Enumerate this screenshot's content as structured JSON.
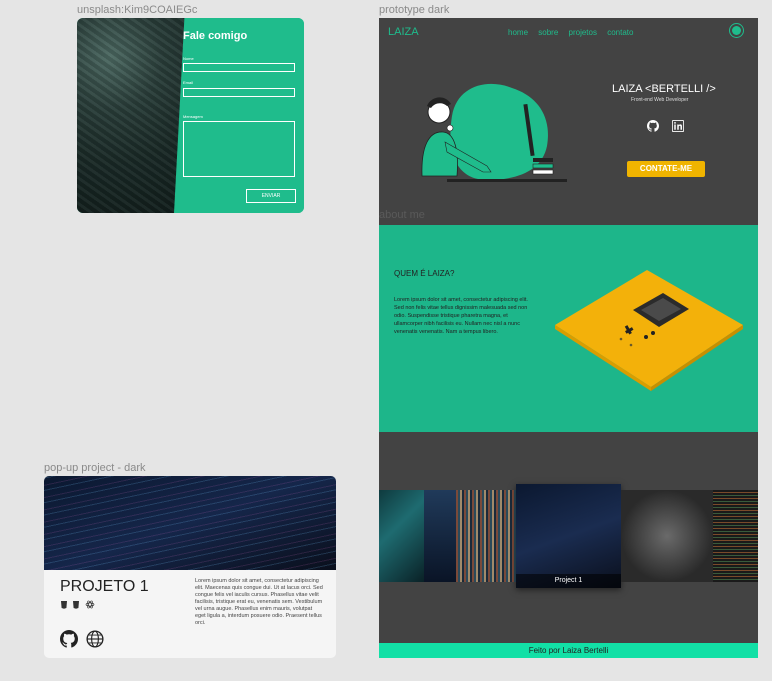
{
  "labels": {
    "contact_frame": "unsplash:Kim9COAIEGc",
    "prototype_frame": "prototype dark",
    "about_frame": "about me",
    "popup_frame": "pop-up project - dark"
  },
  "contact": {
    "title": "Fale comigo",
    "name_label": "Nome",
    "email_label": "Email",
    "message_label": "Mensagem",
    "send_label": "ENVIAR"
  },
  "prototype": {
    "logo": "LAIZA",
    "nav": [
      "home",
      "sobre",
      "projetos",
      "contato"
    ],
    "hero_name": "LAIZA  <BERTELLI />",
    "hero_role": "Front-end Web Developer",
    "cta": "CONTATE-ME",
    "about_title": "QUEM É LAIZA?",
    "about_text": "Lorem ipsum dolor sit amet, consectetur adipiscing elit. Sed non felis vitae tellus dignissim malesuada sed non odio. Suspendisse tristique pharetra magna, et ullamcorper nibh facilisis eu. Nullam nec nisl a nunc venenatis venenatis. Nam a tempus libero.",
    "project_caption": "Project 1",
    "footer": "Feito por Laiza Bertelli"
  },
  "popup": {
    "title": "PROJETO 1",
    "text": "Lorem ipsum dolor sit amet, consectetur adipiscing elit. Maecenas quis congue dui. Ut at lacus orci. Sed congue felis vel iaculis cursus. Phasellus vitae velit facilisis, tristique erat eu, venenatis sem. Vestibulum vel urna augue. Phasellus enim mauris, volutpat eget ligula a, interdum posuere odio. Praesent tellus orci."
  },
  "colors": {
    "accent": "#1fbc8c",
    "dark_bg": "#434343",
    "cta": "#f0b400",
    "footer": "#12e0a6"
  }
}
